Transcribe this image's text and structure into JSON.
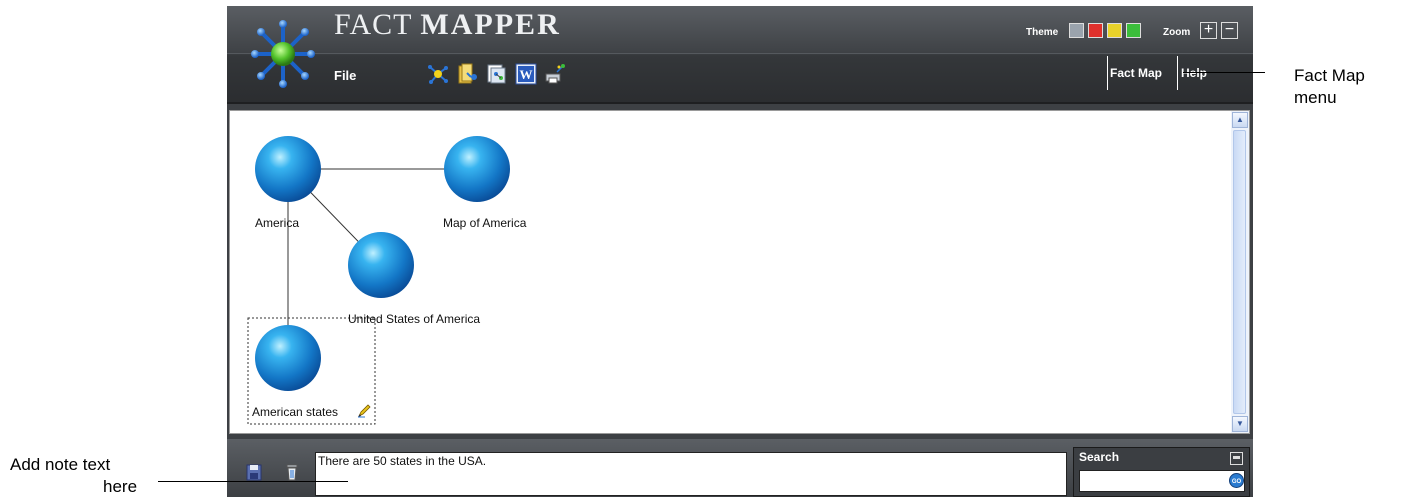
{
  "app": {
    "title_regular": "FACT",
    "title_bold": "MAPPER",
    "file_menu": "File",
    "theme_label": "Theme",
    "zoom_label": "Zoom",
    "zoom_in": "+",
    "zoom_out": "−",
    "fact_map_menu": "Fact Map",
    "help_menu": "Help",
    "theme_colors": [
      "#9aa3ad",
      "#e0302c",
      "#e8d22a",
      "#3bbd3b"
    ],
    "toolbar_icons": [
      "new-map-icon",
      "open-map-icon",
      "export-image-icon",
      "word-export-icon",
      "print-icon"
    ]
  },
  "map": {
    "nodes": [
      {
        "id": "america",
        "label": "America"
      },
      {
        "id": "map-of-america",
        "label": "Map of America"
      },
      {
        "id": "usa",
        "label": "United States of America"
      },
      {
        "id": "american-states",
        "label": "American states",
        "selected": true,
        "has_note": true
      }
    ],
    "edges": [
      [
        "america",
        "map-of-america"
      ],
      [
        "america",
        "usa"
      ],
      [
        "america",
        "american-states"
      ]
    ],
    "node_color": "#1a8fd8"
  },
  "notes": {
    "text": "There are 50 states in the USA."
  },
  "search": {
    "label": "Search",
    "value": ""
  },
  "annotations": {
    "fact_map_menu_line1": "Fact Map",
    "fact_map_menu_line2": "menu",
    "add_note_line1": "Add note text",
    "add_note_line2": "here"
  }
}
